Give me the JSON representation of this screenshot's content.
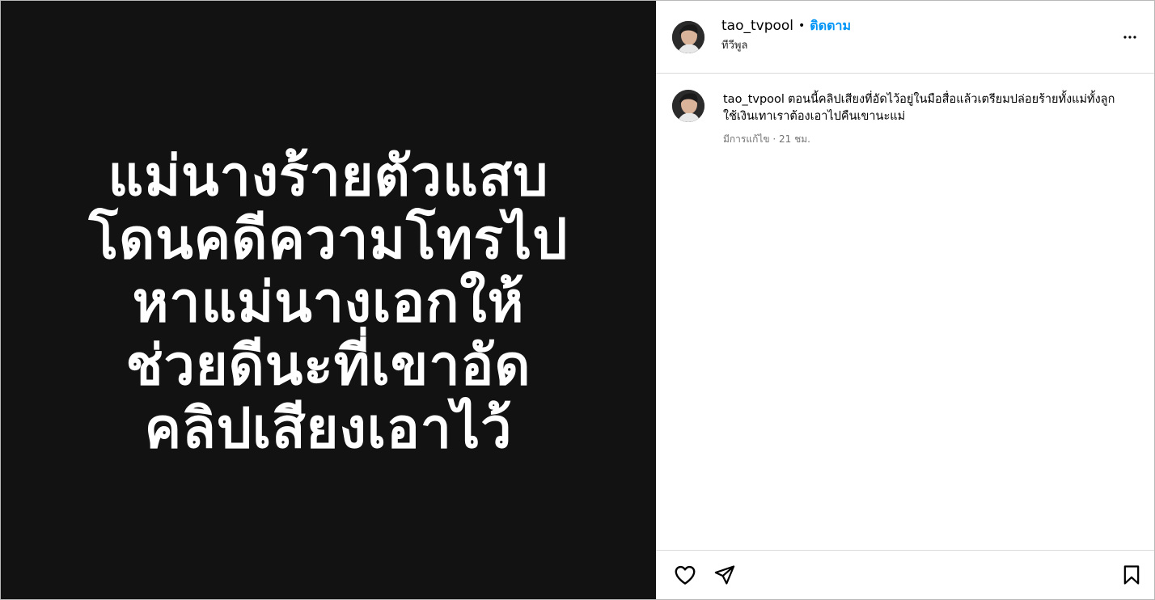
{
  "post": {
    "media": {
      "lines": [
        "แม่นางร้ายตัวแสบ",
        "โดนคดีความโทรไป",
        "หาแม่นางเอกให้",
        "ช่วยดีนะที่เขาอัด",
        "คลิปเสียงเอาไว้"
      ],
      "background": "#121212",
      "text_color": "#ffffff"
    },
    "header": {
      "username": "tao_tvpool",
      "separator": "•",
      "follow_label": "ติดตาม",
      "subtitle": "ทีวีพูล",
      "more_icon": "more-horizontal-icon"
    },
    "caption": {
      "username": "tao_tvpool",
      "text": "ตอนนี้คลิปเสียงที่อัดไว้อยู่ในมือสื่อแล้วเตรียมปล่อยร้ายทั้งแม่ทั้งลูกใช้เงินเทาเราต้องเอาไปคืนเขานะแม่",
      "meta": "มีการแก้ไข · 21 ชม."
    },
    "actions": {
      "like_icon": "heart-icon",
      "share_icon": "send-icon",
      "save_icon": "bookmark-icon"
    },
    "colors": {
      "accent": "#0095f6",
      "divider": "#dbdbdb",
      "muted": "#737373"
    }
  }
}
